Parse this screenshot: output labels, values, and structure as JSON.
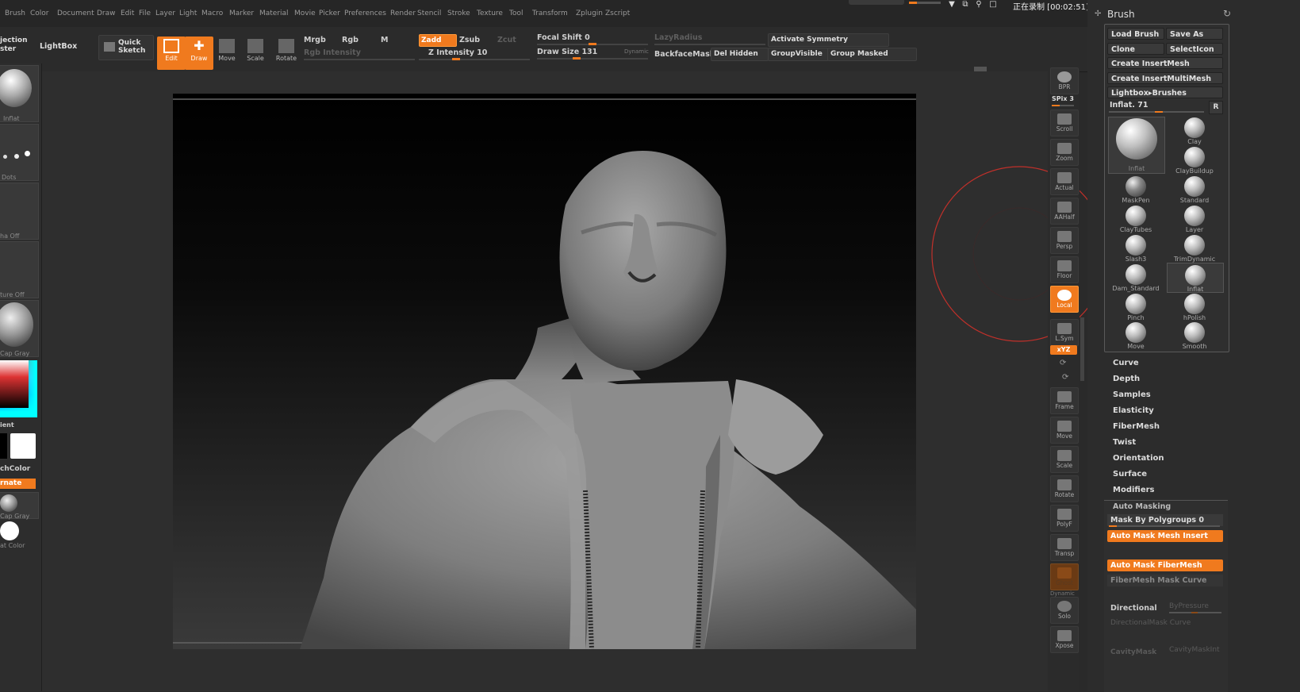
{
  "menu": [
    "Brush",
    "Color",
    "Document",
    "Draw",
    "Edit",
    "File",
    "Layer",
    "Light",
    "Macro",
    "Marker",
    "Material",
    "Movie",
    "Picker",
    "Preferences",
    "Render",
    "Stencil",
    "Stroke",
    "Texture",
    "Tool",
    "Transform",
    "Zplugin",
    "Zscript"
  ],
  "recording": {
    "label": "正在录制 [00:02:51]"
  },
  "toolbar": {
    "projection": "jection\nster",
    "lightbox": "LightBox",
    "quick_sketch": "Quick\nSketch",
    "edit": "Edit",
    "draw": "Draw",
    "move": "Move",
    "scale": "Scale",
    "rotate": "Rotate",
    "mrgb": "Mrgb",
    "rgb": "Rgb",
    "m": "M",
    "rgb_intensity": "Rgb Intensity",
    "zadd": "Zadd",
    "zsub": "Zsub",
    "zcut": "Zcut",
    "z_intensity": "Z Intensity 10",
    "focal_shift": "Focal Shift 0",
    "draw_size": "Draw Size 131",
    "dynamic": "Dynamic",
    "lazy_radius": "LazyRadius",
    "backface_mask": "BackfaceMask",
    "del_hidden": "Del Hidden",
    "activate_symmetry": "Activate Symmetry",
    "group_visible": "GroupVisible",
    "group_masked": "Group Masked"
  },
  "left_shelf": {
    "inflat": "Inflat",
    "dots": "Dots",
    "alpha_off": "ha Off",
    "texture_off": "ture Off",
    "matcap_gray": "Cap Gray",
    "gradient": "ient",
    "switch_color": "chColor",
    "alternate": "rnate",
    "matcap_gray2": "Cap Gray",
    "flat_color": "at Color"
  },
  "right_strip": {
    "bpr": "BPR",
    "spix": "SPix 3",
    "scroll": "Scroll",
    "zoom": "Zoom",
    "actual": "Actual",
    "aahalf": "AAHalf",
    "persp": "Persp",
    "floor": "Floor",
    "local": "Local",
    "lsym": "L.Sym",
    "xyz": "xYZ",
    "frame": "Frame",
    "move": "Move",
    "scale": "Scale",
    "rotate": "Rotate",
    "polyf": "PolyF",
    "transp": "Transp",
    "ghost": "Ghost",
    "dynamic": "Dynamic",
    "solo": "Solo",
    "xpose": "Xpose"
  },
  "brush_panel": {
    "title": "Brush",
    "load_brush": "Load Brush",
    "save_as": "Save As",
    "clone": "Clone",
    "selection": "SelectIcon",
    "create_insertmesh": "Create InsertMesh",
    "create_insertmultimesh": "Create InsertMultiMesh",
    "lightbox_brushes": "Lightbox▸Brushes",
    "current": "Inflat. 71",
    "r": "R",
    "current_brush": "Inflat",
    "brushes": [
      "Clay",
      "ClayBuildup",
      "MaskPen",
      "Standard",
      "ClayTubes",
      "Layer",
      "Slash3",
      "TrimDynamic",
      "Dam_Standard",
      "Inflat",
      "Pinch",
      "hPolish",
      "Move",
      "Smooth"
    ]
  },
  "sections": [
    "Curve",
    "Depth",
    "Samples",
    "Elasticity",
    "FiberMesh",
    "Twist",
    "Orientation",
    "Surface",
    "Modifiers"
  ],
  "auto_masking": {
    "title": "Auto Masking",
    "mask_by_polygroups": "Mask By Polygroups 0",
    "auto_mask_mesh_insert": "Auto Mask Mesh Insert",
    "auto_mask_fibermesh": "Auto Mask FiberMesh",
    "fibermesh_mask_curve": "FiberMesh Mask Curve",
    "directional": "Directional",
    "by_pressure": "ByPressure",
    "directional_mask_curve": "DirectionalMask Curve",
    "cavity_mask": "CavityMask",
    "cavity_mask_int": "CavityMaskInt"
  },
  "colors": {
    "accent": "#f07a1e",
    "panel": "#2c2c2c",
    "canvas": "#000000"
  }
}
